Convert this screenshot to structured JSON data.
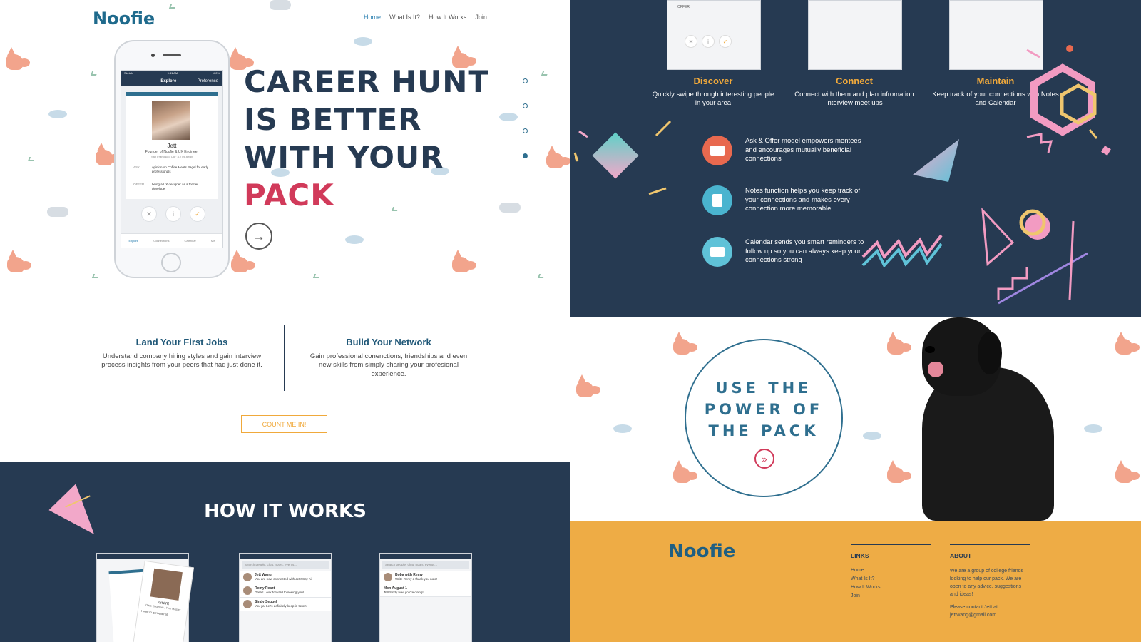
{
  "hero": {
    "brand": "Noofie",
    "nav": [
      "Home",
      "What Is It?",
      "How It Works",
      "Join"
    ],
    "headline": [
      "CAREER HUNT",
      "IS BETTER",
      "WITH YOUR"
    ],
    "headline_accent": "PACK",
    "phone": {
      "status_left": "Sketch",
      "status_time": "9:41 AM",
      "status_battery": "100%",
      "nav_title": "Explore",
      "nav_right": "Preference",
      "profile_name": "Jett",
      "profile_role": "Founder of Noofie & UX Engineer",
      "profile_location": "San Francisco, CA · 4.2 mi away",
      "ask_label": "ASK",
      "ask_text": "opinion on Coffee Meets Bagel for early professionals",
      "offer_label": "OFFER",
      "offer_text": "being a UX designer as a former developer",
      "tabs": [
        "Explore",
        "Connections",
        "Calendar",
        "Me"
      ]
    }
  },
  "benefits": {
    "left_title": "Land Your First Jobs",
    "left_text": "Understand company hiring styles and gain interview process insights from your peers that had just done it.",
    "right_title": "Build Your Network",
    "right_text": "Gain professional conenctions, friendships and even new skills from simply sharing your profesional experience.",
    "cta": "COUNT ME IN!"
  },
  "how": {
    "title": "HOW IT WORKS",
    "screen1_person": "Grant",
    "screen1_role": "Data Engineer / Pun Master",
    "screen1_ask": "I want to get better at",
    "screen2_search": "Search people, chat, notes, events...",
    "screen2_rows": [
      {
        "name": "Jett Wang",
        "text": "You are now connected with Jett! Say hi!",
        "time": "5 mins ago"
      },
      {
        "name": "Remy Reazt",
        "text": "Great! Look forward to seeing you!",
        "time": "6 hours ago"
      },
      {
        "name": "Sindy Sequel",
        "text": "You ya! Let's definitely keep in touch!",
        "time": "17 days ago"
      }
    ],
    "screen3_search": "Search people, chat, notes, events...",
    "screen3_rows": [
      {
        "name": "Boba with Remy",
        "text": "Write Remy a thank you note!"
      },
      {
        "name": "Mon August 1",
        "text": "Tell Sindy how you're doing!"
      }
    ]
  },
  "features": {
    "cols": [
      {
        "title": "Discover",
        "text": "Quickly swipe through interesting people in your area"
      },
      {
        "title": "Connect",
        "text": "Connect with them and plan infromation interview meet ups"
      },
      {
        "title": "Maintain",
        "text": "Keep track of your connections with Notes and Calendar"
      }
    ],
    "items": [
      {
        "text": "Ask & Offer model empowers mentees and encourages mutually beneficial connections",
        "color": "#e8694f"
      },
      {
        "text": "Notes function helps you keep track of your connections and makes every connection more memorable",
        "color": "#4ab4cf"
      },
      {
        "text": "Calendar sends you smart reminders to follow up so you can always keep your connections strong",
        "color": "#5fc2d8"
      }
    ],
    "screen1_offer": "OFFER"
  },
  "pack": {
    "text": [
      "USE THE",
      "POWER OF",
      "THE PACK"
    ]
  },
  "footer": {
    "brand": "Noofie",
    "links_title": "LINKS",
    "links": [
      "Home",
      "What Is It?",
      "How It Works",
      "Join"
    ],
    "about_title": "ABOUT",
    "about_text": "We are a group of college friends looking to help our pack. We are open to any advice, suggestions and ideas!",
    "contact_text": "Please contact Jett at jettwang@gmail.com"
  },
  "colors": {
    "navy": "#263a52",
    "accent_pink": "#d13a5a",
    "accent_orange": "#f0a93b",
    "brand_blue": "#1f6a8c",
    "footer_bg": "#eeac45"
  }
}
